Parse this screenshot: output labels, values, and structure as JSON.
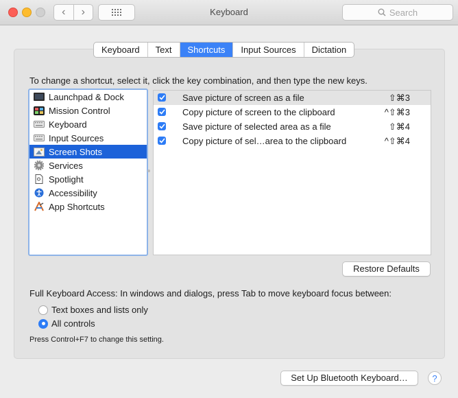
{
  "window": {
    "title": "Keyboard",
    "search_placeholder": "Search"
  },
  "tabs": [
    {
      "label": "Keyboard"
    },
    {
      "label": "Text"
    },
    {
      "label": "Shortcuts"
    },
    {
      "label": "Input Sources"
    },
    {
      "label": "Dictation"
    }
  ],
  "active_tab": "Shortcuts",
  "instruction": "To change a shortcut, select it, click the key combination, and then type the new keys.",
  "categories": [
    {
      "label": "Launchpad & Dock",
      "icon": "launchpad-icon"
    },
    {
      "label": "Mission Control",
      "icon": "mission-control-icon"
    },
    {
      "label": "Keyboard",
      "icon": "keyboard-icon"
    },
    {
      "label": "Input Sources",
      "icon": "keyboard-icon"
    },
    {
      "label": "Screen Shots",
      "icon": "screenshot-icon",
      "selected": true
    },
    {
      "label": "Services",
      "icon": "gear-icon"
    },
    {
      "label": "Spotlight",
      "icon": "document-icon"
    },
    {
      "label": "Accessibility",
      "icon": "accessibility-icon"
    },
    {
      "label": "App Shortcuts",
      "icon": "app-store-icon"
    }
  ],
  "shortcuts": [
    {
      "label": "Save picture of screen as a file",
      "key": "⇧⌘3",
      "checked": true
    },
    {
      "label": "Copy picture of screen to the clipboard",
      "key": "^⇧⌘3",
      "checked": true
    },
    {
      "label": "Save picture of selected area as a file",
      "key": "⇧⌘4",
      "checked": true
    },
    {
      "label": "Copy picture of sel…area to the clipboard",
      "key": "^⇧⌘4",
      "checked": true
    }
  ],
  "restore_label": "Restore Defaults",
  "full_keyboard_access": {
    "label": "Full Keyboard Access: In windows and dialogs, press Tab to move keyboard focus between:",
    "options": [
      {
        "label": "Text boxes and lists only",
        "selected": false
      },
      {
        "label": "All controls",
        "selected": true
      }
    ],
    "hint": "Press Control+F7 to change this setting."
  },
  "bluetooth_label": "Set Up Bluetooth Keyboard…",
  "help_label": "?",
  "colors": {
    "accent": "#2d7cf6",
    "selection": "#1c62d9"
  }
}
